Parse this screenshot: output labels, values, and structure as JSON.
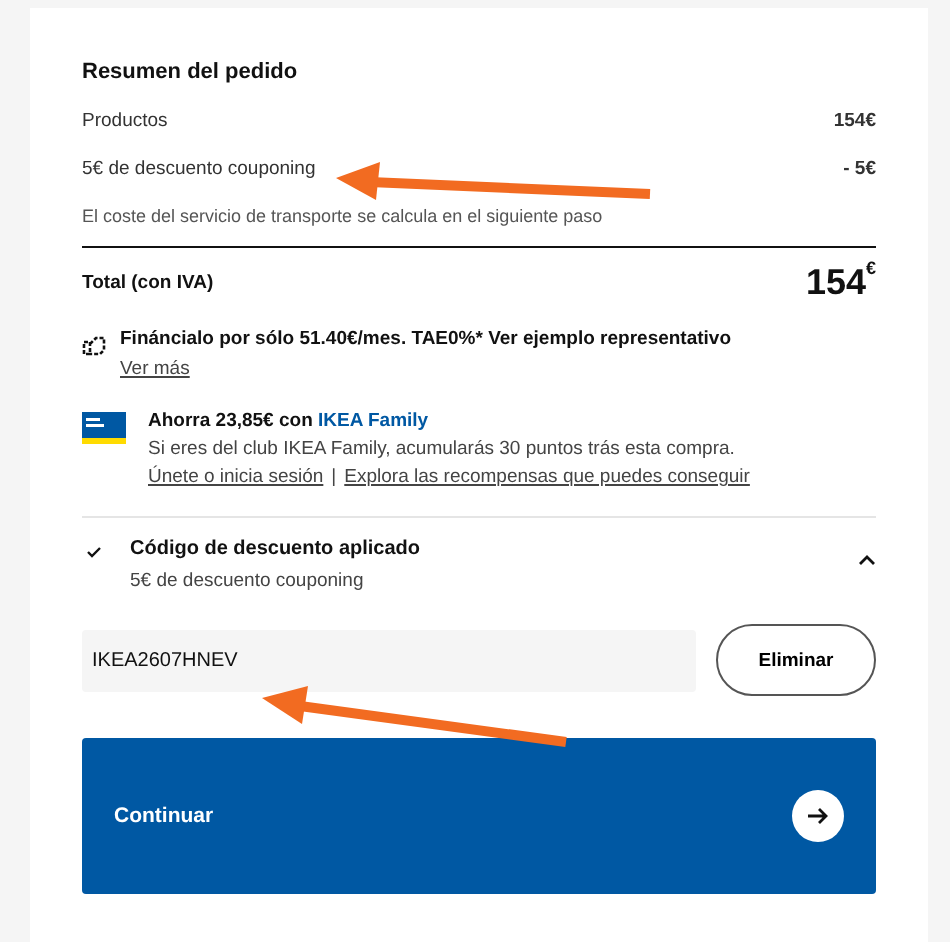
{
  "summary": {
    "title": "Resumen del pedido",
    "lines": [
      {
        "label": "Productos",
        "amount": "154€"
      },
      {
        "label": "5€ de descuento couponing",
        "amount": "- 5€"
      }
    ],
    "note": "El coste del servicio de transporte se calcula en el siguiente paso",
    "total_label": "Total (con IVA)",
    "total_amount": "154$^{€}$"
  },
  "financing": {
    "text": "Fináncialo por sólo 51.40€/mes. TAE0%* Ver ejemplo representativo",
    "link": "Ver más"
  },
  "family": {
    "title": "Ahorra 23,85€ con ",
    "title_link": "IKEA Family",
    "text": "Si eres del club IKEA Family, acumularás 30 puntos trás esta compra.",
    "links": [
      "Únete o inicia sesión",
      "Explora las recompensas que puedes conseguir"
    ],
    "separator": "|"
  },
  "discount": {
    "title": "Código de descuento aplicado",
    "subtitle": "5€ de descuento couponing",
    "expanded": true,
    "code": "IKEA2607HNEV",
    "remove_button": "Eliminar"
  },
  "continue_button": "Continuar"
}
